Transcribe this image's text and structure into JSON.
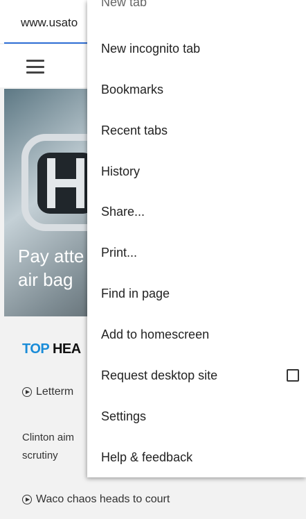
{
  "browser": {
    "url_text": "www.usato"
  },
  "page": {
    "hero_caption_line1": "Pay atte",
    "hero_caption_line2": "air bag",
    "section_title_accent": "TOP",
    "section_title_rest": "HEA",
    "headlines": [
      "Letterm",
      "Clinton aim",
      "scrutiny",
      "Waco chaos heads to court"
    ]
  },
  "menu": {
    "items": [
      "New tab",
      "New incognito tab",
      "Bookmarks",
      "Recent tabs",
      "History",
      "Share...",
      "Print...",
      "Find in page",
      "Add to homescreen",
      "Request desktop site",
      "Settings",
      "Help & feedback"
    ],
    "request_desktop_checked": false
  }
}
